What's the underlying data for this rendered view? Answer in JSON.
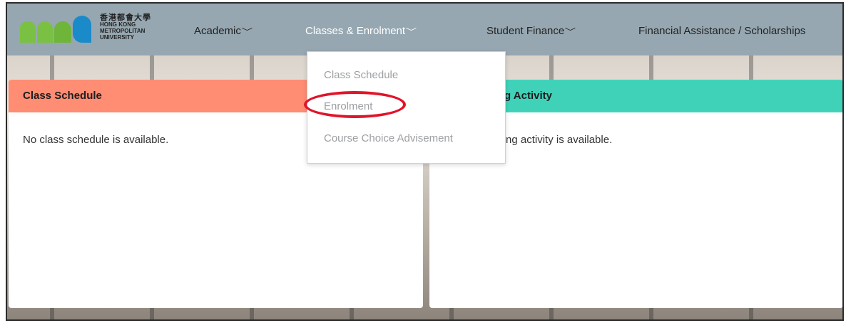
{
  "logo": {
    "cn": "香港都會大學",
    "en_lines": [
      "HONG KONG",
      "METROPOLITAN",
      "UNIVERSITY"
    ]
  },
  "nav": {
    "items": [
      {
        "label": "Academic"
      },
      {
        "label": "Classes & Enrolment"
      },
      {
        "label": "Student Finance"
      },
      {
        "label": "Financial Assistance / Scholarships"
      }
    ],
    "chevron": "﹀"
  },
  "dropdown": {
    "items": [
      "Class Schedule",
      "Enrolment",
      "Course Choice Advisement"
    ]
  },
  "panels": {
    "left": {
      "title": "Class Schedule",
      "message": "No class schedule is available."
    },
    "right": {
      "title": "g Activity",
      "message": "ng activity is available."
    }
  },
  "colors": {
    "navbar": "#96a7b1",
    "left_header": "#fe8d74",
    "right_header": "#40d2b9",
    "highlight": "#e0142a",
    "logo_green": "#7ac143",
    "logo_blue": "#1b8ac9"
  }
}
